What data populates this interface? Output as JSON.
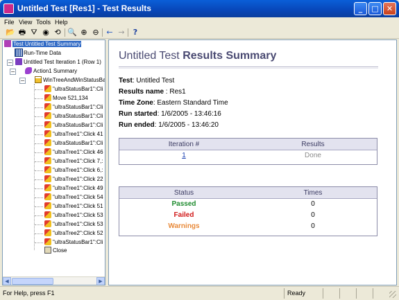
{
  "window": {
    "title": "Untitled Test [Res1] - Test Results",
    "app_icon": "qtp-app-icon",
    "minimize": "_",
    "maximize": "□",
    "close": "✕"
  },
  "menu": [
    "File",
    "View",
    "Tools",
    "Help"
  ],
  "toolbar": {
    "icons": [
      "open-icon",
      "print-icon",
      "filter-icon",
      "find-icon",
      "jump-to-step-icon",
      "preview-icon",
      "zoom-in-icon",
      "zoom-out-icon",
      "back-arrow-icon",
      "forward-arrow-icon",
      "help-icon"
    ],
    "glyphs": [
      "📂",
      "🖶",
      "⛛",
      "◉",
      "⟲",
      "🔍",
      "⊕",
      "⊖",
      "←",
      "→",
      "?"
    ]
  },
  "tree": {
    "root": "Test Untitled Test Summary",
    "runtime": "Run-Time Data",
    "iteration": "Untitled Test Iteration 1 (Row 1)",
    "action": "Action1 Summary",
    "window_node": "WinTreeAndWinStatusBa",
    "steps": [
      "\"ultraStatusBar1\":Cli",
      "Move 521,134",
      "\"ultraStatusBar1\":Cli",
      "\"ultraStatusBar1\":Cli",
      "\"ultraStatusBar1\":Cli",
      "\"ultraTree1\":Click 41",
      "\"ultraStatusBar1\":Cli",
      "\"ultraTree1\":Click 46",
      "\"ultraTree1\":Click 7,:",
      "\"ultraTree1\":Click 6,:",
      "\"ultraTree1\":Click 22",
      "\"ultraTree1\":Click 49",
      "\"ultraTree1\":Click 54",
      "\"ultraTree1\":Click 51",
      "\"ultraTree1\":Click 53",
      "\"ultraTree1\":Click 53",
      "\"ultraTree2\":Click 52",
      "\"ultraStatusBar1\":Cli"
    ],
    "close_step": "Close",
    "expander_minus": "−"
  },
  "summary": {
    "heading_plain": "Untitled Test ",
    "heading_bold": "Results Summary",
    "test_label": "Test",
    "test_value": ": Untitled Test",
    "results_label": "Results name",
    "results_value": " : Res1",
    "tz_label": "Time Zone",
    "tz_value": ": Eastern Standard Time",
    "started_label": "Run started",
    "started_value": ": 1/6/2005 - 13:46:16",
    "ended_label": "Run ended",
    "ended_value": ": 1/6/2005 - 13:46:20"
  },
  "iteration_table": {
    "headers": [
      "Iteration #",
      "Results"
    ],
    "rows": [
      {
        "iteration": "1",
        "result": "Done"
      }
    ]
  },
  "status_table": {
    "headers": [
      "Status",
      "Times"
    ],
    "rows": [
      {
        "status": "Passed",
        "times": "0"
      },
      {
        "status": "Failed",
        "times": "0"
      },
      {
        "status": "Warnings",
        "times": "0"
      }
    ]
  },
  "statusbar": {
    "help": "For Help, press F1",
    "state": "Ready"
  },
  "colors": {
    "passed": "#1e8b2e",
    "failed": "#d11818",
    "warnings": "#e88a3a",
    "link": "#1a3fb0",
    "selection": "#316ac5"
  }
}
